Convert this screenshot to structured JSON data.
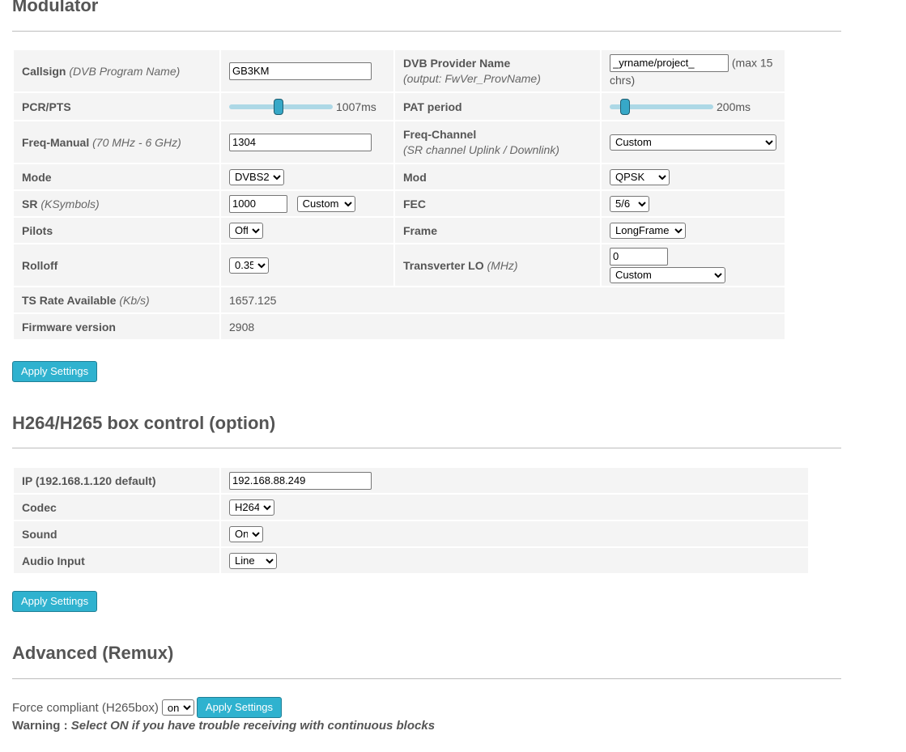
{
  "modulator": {
    "title": "Modulator",
    "callsign": {
      "label": "Callsign",
      "hint": "(DVB Program Name)",
      "value": "GB3KM"
    },
    "provider": {
      "label": "DVB Provider Name",
      "sub": "(output: FwVer_ProvName)",
      "value": "_yrname/project_",
      "note": "(max 15 chrs)"
    },
    "pcr": {
      "label": "PCR/PTS",
      "value": "1007ms",
      "level": 0.48
    },
    "pat": {
      "label": "PAT period",
      "value": "200ms",
      "level": 0.15
    },
    "freq": {
      "label": "Freq-Manual",
      "hint": "(70 MHz - 6 GHz)",
      "value": "1304"
    },
    "freq_channel": {
      "label": "Freq-Channel",
      "sub": "(SR channel Uplink / Downlink)",
      "value": "Custom"
    },
    "mode": {
      "label": "Mode",
      "value": "DVBS2"
    },
    "mod": {
      "label": "Mod",
      "value": "QPSK"
    },
    "sr": {
      "label": "SR",
      "hint": "(KSymbols)",
      "value": "1000",
      "preset": "Custom"
    },
    "fec": {
      "label": "FEC",
      "value": "5/6"
    },
    "pilots": {
      "label": "Pilots",
      "value": "Off"
    },
    "frame": {
      "label": "Frame",
      "value": "LongFrame"
    },
    "rolloff": {
      "label": "Rolloff",
      "value": "0.35"
    },
    "transverter": {
      "label": "Transverter LO",
      "hint": "(MHz)",
      "value": "0",
      "preset": "Custom"
    },
    "ts_rate": {
      "label": "TS Rate Available",
      "hint": "(Kb/s)",
      "value": "1657.125"
    },
    "firmware": {
      "label": "Firmware version",
      "value": "2908"
    },
    "apply_label": "Apply Settings"
  },
  "h264": {
    "title": "H264/H265 box control (option)",
    "ip": {
      "label": "IP (192.168.1.120 default)",
      "value": "192.168.88.249"
    },
    "codec": {
      "label": "Codec",
      "value": "H264"
    },
    "sound": {
      "label": "Sound",
      "value": "On"
    },
    "audio": {
      "label": "Audio Input",
      "value": "Line"
    },
    "apply_label": "Apply Settings"
  },
  "advanced": {
    "title": "Advanced (Remux)",
    "force_label": "Force compliant (H265box)",
    "force_value": "on",
    "apply_label": "Apply Settings",
    "warning_prefix": "Warning :",
    "warning_text": "Select ON if you have trouble receiving with continuous blocks"
  },
  "colors": {
    "accent": "#2fb2cf",
    "slider_track": "#add8e6",
    "row_bg": "#f4f4f4"
  }
}
